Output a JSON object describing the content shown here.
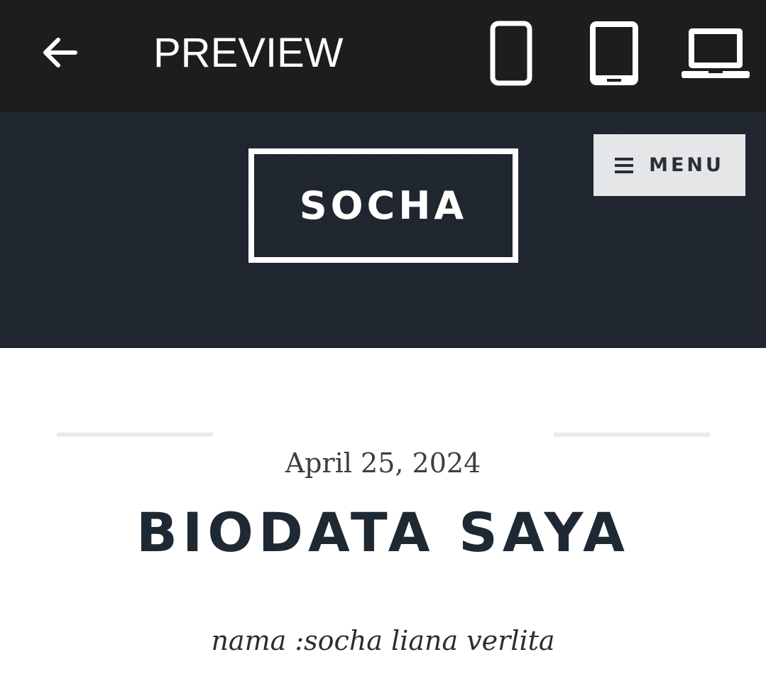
{
  "topbar": {
    "back_icon": "arrow-left-icon",
    "title": "PREVIEW",
    "devices": [
      {
        "icon": "mobile-phone-icon"
      },
      {
        "icon": "tablet-icon"
      },
      {
        "icon": "laptop-icon"
      }
    ]
  },
  "site": {
    "logo": "SOCHA",
    "menu_icon": "hamburger-icon",
    "menu_label": "MENU",
    "header_bg": "#202630"
  },
  "post": {
    "date": "April 25, 2024",
    "title": "BIODATA SAYA",
    "body": "nama :socha liana verlita"
  },
  "colors": {
    "topbar": "#1c1d1f",
    "menu_button": "#e4e6e8",
    "title_text": "#1f2933"
  }
}
